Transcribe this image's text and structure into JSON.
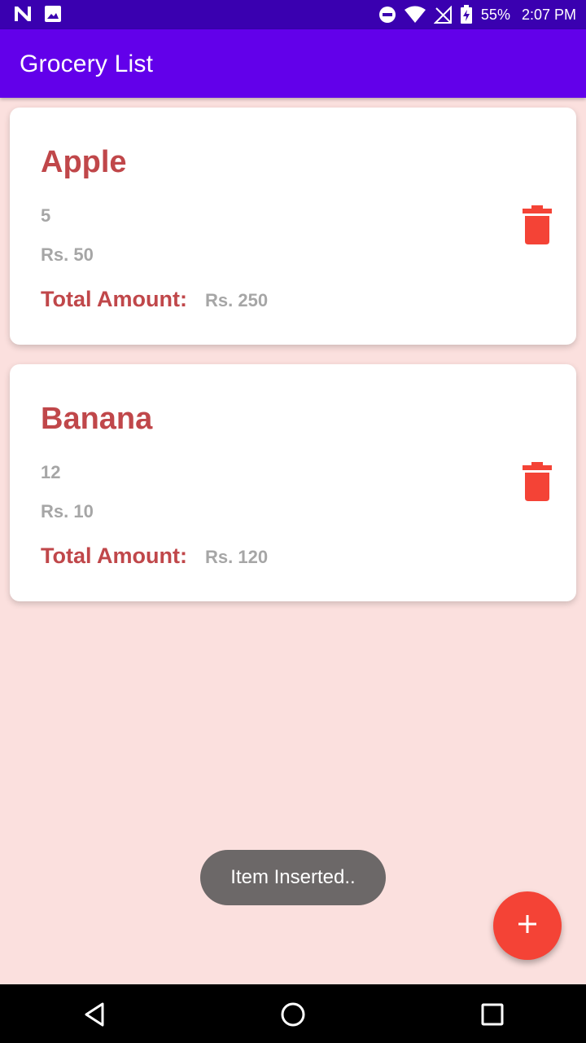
{
  "status_bar": {
    "battery": "55%",
    "time": "2:07 PM",
    "icons": [
      "n-icon",
      "image-icon",
      "do-not-disturb-icon",
      "wifi-icon",
      "signal-off-icon",
      "battery-charging-icon"
    ]
  },
  "app_bar": {
    "title": "Grocery List",
    "color": "#6200ea"
  },
  "items": [
    {
      "name": "Apple",
      "quantity": "5",
      "rate": "Rs. 50",
      "total_label": "Total Amount:",
      "total_value": "Rs. 250"
    },
    {
      "name": "Banana",
      "quantity": "12",
      "rate": "Rs. 10",
      "total_label": "Total Amount:",
      "total_value": "Rs. 120"
    }
  ],
  "toast": {
    "message": "Item Inserted.."
  },
  "fab": {
    "icon": "plus-icon",
    "color": "#f44336"
  },
  "nav_bar": {
    "buttons": [
      "back-icon",
      "home-icon",
      "recents-icon"
    ]
  },
  "colors": {
    "background": "#fbe0de",
    "accent_text": "#c0474a",
    "muted_text": "#a6a6a6",
    "delete": "#f44336"
  }
}
